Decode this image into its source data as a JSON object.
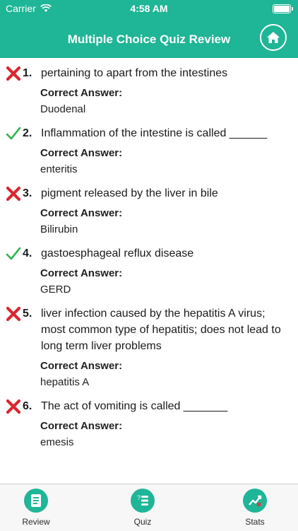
{
  "status_bar": {
    "carrier": "Carrier",
    "time": "4:58 AM"
  },
  "header": {
    "title": "Multiple Choice Quiz Review",
    "home_icon": "home-icon"
  },
  "items": [
    {
      "num": "1.",
      "correct": false,
      "question": "pertaining to apart from the intestines",
      "answer_label": "Correct Answer:",
      "answer": "Duodenal"
    },
    {
      "num": "2.",
      "correct": true,
      "question": "Inflammation of the intestine is called ______",
      "answer_label": "Correct Answer:",
      "answer": "enteritis"
    },
    {
      "num": "3.",
      "correct": false,
      "question": "pigment released by the liver in bile",
      "answer_label": "Correct Answer:",
      "answer": "Bilirubin"
    },
    {
      "num": "4.",
      "correct": true,
      "question": "gastoesphageal reflux disease",
      "answer_label": "Correct Answer:",
      "answer": "GERD"
    },
    {
      "num": "5.",
      "correct": false,
      "question": "liver infection caused by the hepatitis A virus; most common type of hepatitis; does not lead to long term liver problems",
      "answer_label": "Correct Answer:",
      "answer": "hepatitis A"
    },
    {
      "num": "6.",
      "correct": false,
      "question": "The act of vomiting is called _______",
      "answer_label": "Correct Answer:",
      "answer": "emesis"
    }
  ],
  "tabs": [
    {
      "label": "Review",
      "icon": "review-icon"
    },
    {
      "label": "Quiz",
      "icon": "quiz-icon"
    },
    {
      "label": "Stats",
      "icon": "stats-icon"
    }
  ],
  "colors": {
    "accent": "#1fb597",
    "wrong": "#d9272e",
    "correct": "#2db34a"
  }
}
